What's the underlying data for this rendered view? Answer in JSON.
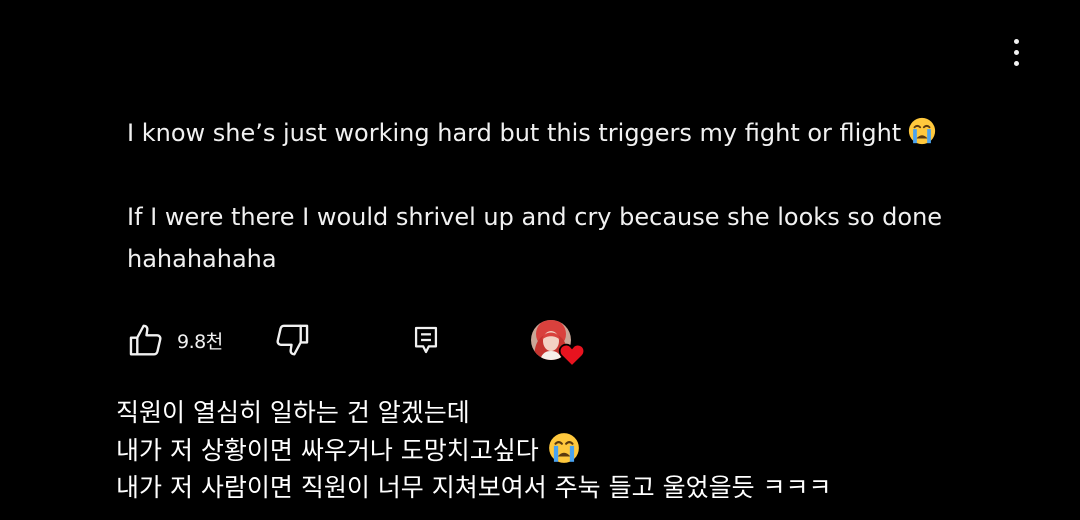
{
  "menu": {
    "icon": "more-vertical-icon"
  },
  "comment": {
    "paragraph1": "I know she’s just working hard but this triggers my fight or flight",
    "paragraph1_emoji": "loudly-crying-face-emoji",
    "paragraph2": "If I were there I would shrivel up and cry because she looks so done hahahahaha"
  },
  "actions": {
    "like_icon": "thumbs-up-icon",
    "like_count": "9.8천",
    "dislike_icon": "thumbs-down-icon",
    "reply_icon": "reply-comment-icon",
    "creator_heart_icon": "heart-icon"
  },
  "translation": {
    "line1": "직원이 열심히 일하는 건 알겠는데",
    "line2": "내가 저 상황이면 싸우거나 도망치고싶다",
    "line2_emoji": "loudly-crying-face-emoji",
    "line3": "내가 저 사람이면 직원이 너무 지쳐보여서 주눅 들고 울었을듯 ㅋㅋㅋ"
  },
  "colors": {
    "background": "#000000",
    "text": "#f1f1f1",
    "heart": "#e8131f",
    "emoji_face": "#ffc83d",
    "emoji_tears": "#4aa3f0"
  }
}
